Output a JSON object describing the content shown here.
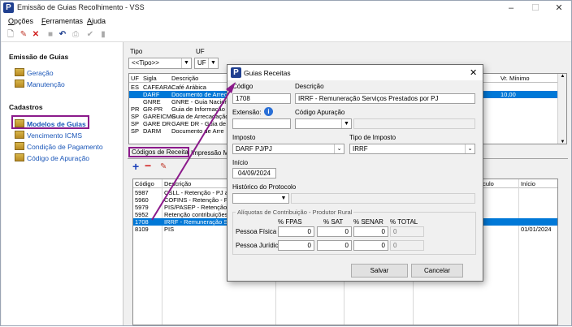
{
  "window": {
    "title": "Emissão de Guias Recolhimento - VSS",
    "icon_letter": "P"
  },
  "menu": [
    {
      "label": "Opções",
      "u": "O",
      "rest": "pções"
    },
    {
      "label": "Ferramentas",
      "u": "F",
      "rest": "erramentas"
    },
    {
      "label": "Ajuda",
      "u": "A",
      "rest": "juda"
    }
  ],
  "sidebar": {
    "section1": "Emissão de Guias",
    "items1": [
      "Geração",
      "Manutenção"
    ],
    "section2": "Cadastros",
    "items2": [
      "Modelos de Guias",
      "Vencimento ICMS",
      "Condição de Pagamento",
      "Código de Apuração"
    ]
  },
  "filters": {
    "tipo_label": "Tipo",
    "tipo_value": "<<Tipo>>",
    "uf_label": "UF",
    "uf_value": "UF"
  },
  "top_grid": {
    "headers": [
      "UF",
      "Sigla",
      "Descrição",
      "Vr. Mínimo"
    ],
    "rows": [
      [
        "ES",
        "CAFEARA",
        "Café Arábica",
        ""
      ],
      [
        "",
        "DARF",
        "Documento de Arrecadação",
        "10,00"
      ],
      [
        "",
        "GNRE",
        "GNRE - Guia Nacional",
        ""
      ],
      [
        "PR",
        "GR-PR",
        "Guia de Informação",
        ""
      ],
      [
        "SP",
        "GAREICMS",
        "Guia de Arrecadação",
        ""
      ],
      [
        "SP",
        "GARE DR",
        "GARE DR - Guia de",
        ""
      ],
      [
        "SP",
        "DARM",
        "Documento de Arre",
        ""
      ]
    ],
    "selected_row": 1
  },
  "tabs": [
    "Códigos de Receita",
    "Impressão Ma"
  ],
  "bottom_grid": {
    "headers": [
      "Código",
      "Descrição",
      "ículo",
      "Início"
    ],
    "rows": [
      [
        "5987",
        "CSLL - Retenção - PJ a",
        ""
      ],
      [
        "5960",
        "COFINS - Retenção - P",
        ""
      ],
      [
        "5979",
        "PIS/PASEP - Retenção -",
        ""
      ],
      [
        "5952",
        "Retenção contribuições",
        ""
      ],
      [
        "1708",
        "IRRF - Remuneração Se",
        ""
      ],
      [
        "8109",
        "PIS",
        "01/01/2024"
      ]
    ],
    "selected_row": 4
  },
  "dialog": {
    "title": "Guias Receitas",
    "close": "✕",
    "codigo_label": "Código",
    "codigo_value": "1708",
    "descricao_label": "Descrição",
    "descricao_value": "IRRF - Remuneração Serviços Prestados por PJ",
    "extensao_label": "Extensão:",
    "info_icon": "i",
    "codigo_apuracao_label": "Código Apuração",
    "imposto_label": "Imposto",
    "imposto_value": "DARF PJ/PJ",
    "tipo_imposto_label": "Tipo de Imposto",
    "tipo_imposto_value": "IRRF",
    "inicio_label": "Início",
    "inicio_value": "04/09/2024",
    "historico_label": "Histórico do Protocolo",
    "group_label": "Alíquotas de Contribuição - Produtor Rural",
    "col_headers": [
      "% FPAS",
      "% SAT",
      "% SENAR",
      "% TOTAL"
    ],
    "rows": [
      {
        "label": "Pessoa Física",
        "values": [
          "0",
          "0",
          "0",
          "0"
        ]
      },
      {
        "label": "Pessoa Jurídica",
        "values": [
          "0",
          "0",
          "0",
          "0"
        ]
      }
    ],
    "save_label": "Salvar",
    "cancel_label": "Cancelar"
  },
  "colors": {
    "accent": "#0078d7",
    "highlight": "#8b1a8b",
    "link": "#1a56b8"
  }
}
